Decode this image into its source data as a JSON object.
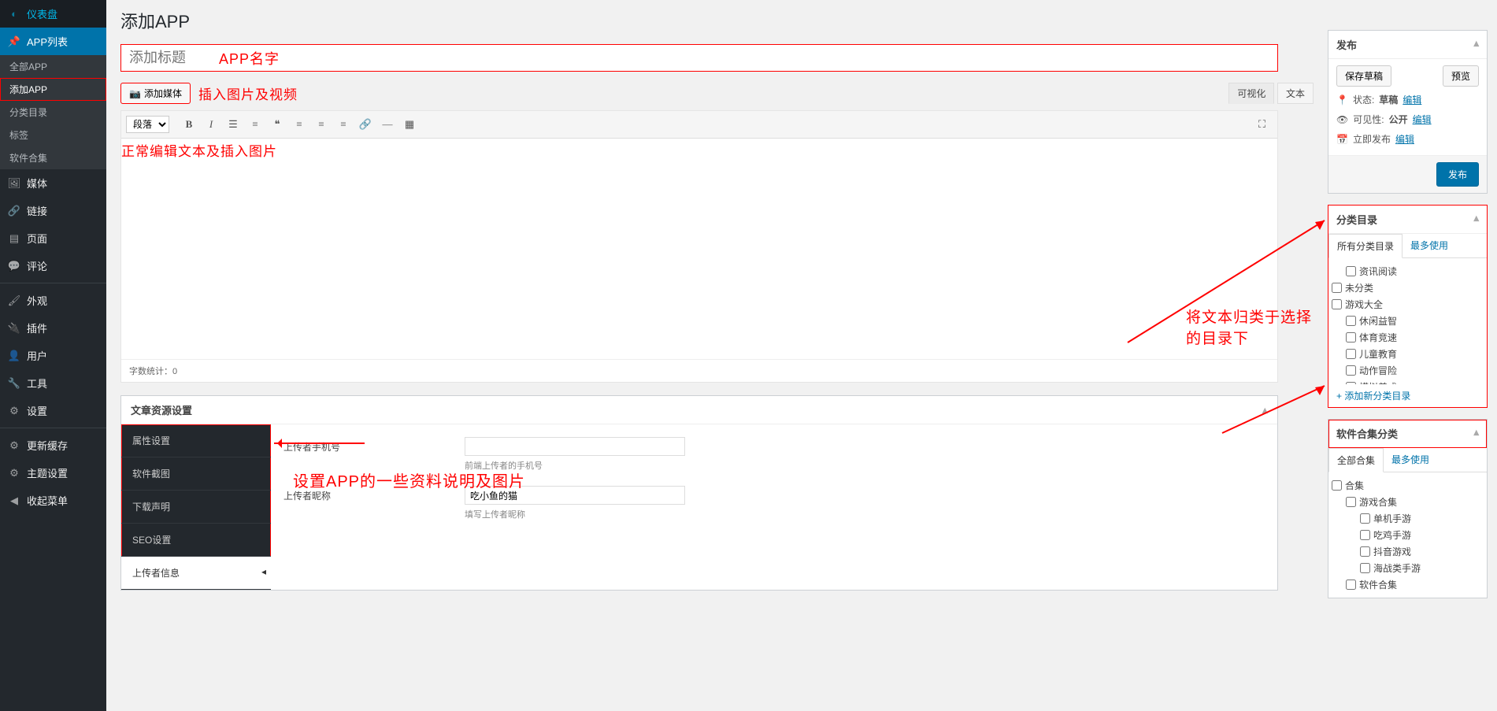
{
  "sidebar": {
    "items": [
      {
        "icon": "◐",
        "label": "仪表盘"
      },
      {
        "icon": "📌",
        "label": "APP列表",
        "current": true,
        "subs": [
          "全部APP",
          "添加APP",
          "分类目录",
          "标签",
          "软件合集"
        ],
        "subActive": 1
      },
      {
        "icon": "🖼",
        "label": "媒体"
      },
      {
        "icon": "🔗",
        "label": "链接"
      },
      {
        "icon": "▤",
        "label": "页面"
      },
      {
        "icon": "💬",
        "label": "评论"
      },
      {
        "sep": true
      },
      {
        "icon": "🖌",
        "label": "外观"
      },
      {
        "icon": "🔌",
        "label": "插件"
      },
      {
        "icon": "👤",
        "label": "用户"
      },
      {
        "icon": "🔧",
        "label": "工具"
      },
      {
        "icon": "⚙",
        "label": "设置"
      },
      {
        "sep": true
      },
      {
        "icon": "⚙",
        "label": "更新缓存"
      },
      {
        "icon": "⚙",
        "label": "主题设置"
      },
      {
        "icon": "◀",
        "label": "收起菜单"
      }
    ]
  },
  "page": {
    "title": "添加APP"
  },
  "title_placeholder": "添加标题",
  "media_button": "添加媒体",
  "editor": {
    "tabs": [
      "可视化",
      "文本"
    ],
    "format": "段落",
    "word_count_label": "字数统计：",
    "word_count": "0"
  },
  "metabox_resource": {
    "title": "文章资源设置",
    "tabs": [
      "属性设置",
      "软件截图",
      "下载声明",
      "SEO设置",
      "上传者信息"
    ],
    "active": 4,
    "fields": [
      {
        "label": "上传者手机号",
        "value": "",
        "hint": "前端上传者的手机号"
      },
      {
        "label": "上传者昵称",
        "value": "吃小鱼的猫",
        "hint": "填写上传者昵称"
      }
    ]
  },
  "publish": {
    "title": "发布",
    "save_draft": "保存草稿",
    "preview": "预览",
    "status_label": "状态:",
    "status_value": "草稿",
    "edit": "编辑",
    "visibility_label": "可见性:",
    "visibility_value": "公开",
    "publish_label": "立即发布",
    "submit": "发布"
  },
  "categories": {
    "title": "分类目录",
    "tabs": [
      "所有分类目录",
      "最多使用"
    ],
    "items": [
      {
        "label": "资讯阅读",
        "indent": 1
      },
      {
        "label": "未分类",
        "indent": 0
      },
      {
        "label": "游戏大全",
        "indent": 0
      },
      {
        "label": "休闲益智",
        "indent": 1
      },
      {
        "label": "体育竞速",
        "indent": 1
      },
      {
        "label": "儿童教育",
        "indent": 1
      },
      {
        "label": "动作冒险",
        "indent": 1
      },
      {
        "label": "模拟养成",
        "indent": 1
      }
    ],
    "add_link": "+ 添加新分类目录"
  },
  "software_sets": {
    "title": "软件合集分类",
    "tabs": [
      "全部合集",
      "最多使用"
    ],
    "items": [
      {
        "label": "合集",
        "indent": 0
      },
      {
        "label": "游戏合集",
        "indent": 1
      },
      {
        "label": "单机手游",
        "indent": 2
      },
      {
        "label": "吃鸡手游",
        "indent": 2
      },
      {
        "label": "抖音游戏",
        "indent": 2
      },
      {
        "label": "海战类手游",
        "indent": 2
      },
      {
        "label": "软件合集",
        "indent": 1
      }
    ]
  },
  "annotations": {
    "app_name": "APP名字",
    "insert_media": "插入图片及视频",
    "normal_edit": "正常编辑文本及插入图片",
    "set_app_info": "设置APP的一些资料说明及图片",
    "categorize": "将文本归类于选择的目录下"
  }
}
